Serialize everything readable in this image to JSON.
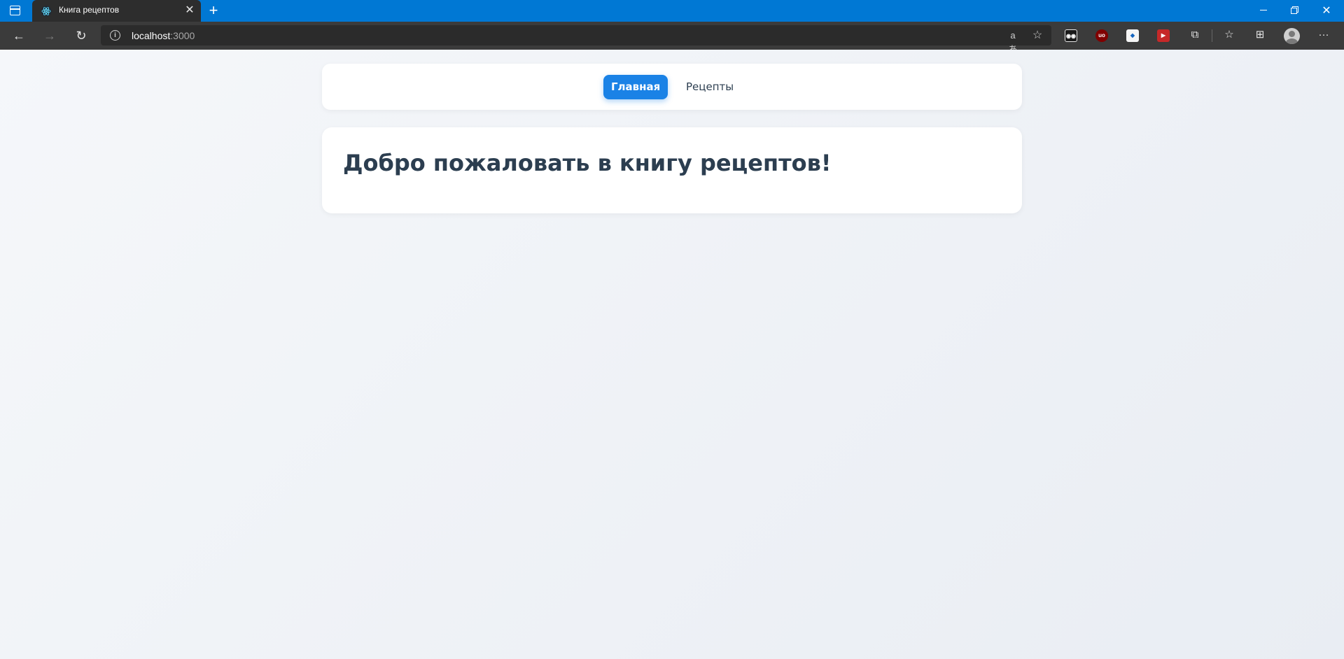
{
  "browser": {
    "tab": {
      "title": "Книга рецептов",
      "favicon": "react-icon",
      "close_glyph": "✕"
    },
    "new_tab_glyph": "+",
    "window": {
      "close_glyph": "✕"
    },
    "toolbar": {
      "back_glyph": "←",
      "forward_glyph": "→",
      "refresh_glyph": "↻",
      "address": {
        "host": "localhost",
        "port": ":3000"
      },
      "read_aloud_glyph": "aあ",
      "favorite_glyph": "☆",
      "extensions": [
        {
          "name": "ext-reader-icon",
          "text": "◉◉",
          "color": "#1a1a1a"
        },
        {
          "name": "ext-ublock-icon",
          "text": "uo",
          "color": "#800000"
        },
        {
          "name": "ext-dev-icon",
          "text": "◆",
          "color": "#1565c0"
        },
        {
          "name": "ext-video-icon",
          "text": "▶",
          "color": "#c62828"
        }
      ],
      "puzzle_glyph": "⧉",
      "favorites_glyph": "☆",
      "collections_glyph": "⊞",
      "more_glyph": "···"
    }
  },
  "site": {
    "nav": {
      "items": [
        {
          "label": "Главная",
          "active": true
        },
        {
          "label": "Рецепты",
          "active": false
        }
      ]
    },
    "main": {
      "heading": "Добро пожаловать в книгу рецептов!"
    }
  },
  "colors": {
    "titlebar": "#0078d4",
    "accent": "#1a82e6",
    "text": "#2c3e50"
  }
}
